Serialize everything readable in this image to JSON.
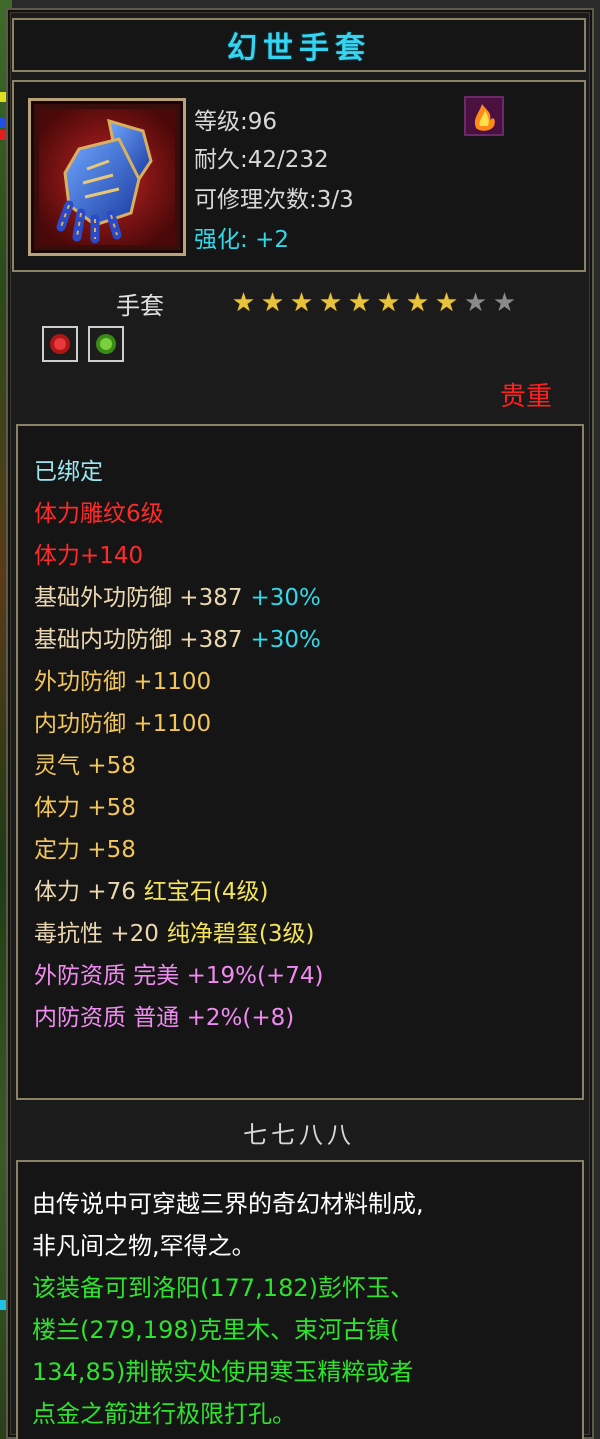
{
  "item": {
    "name": "幻世手套",
    "level_text": "等级:96",
    "durability_text": "耐久:42/232",
    "repairs_text": "可修理次数:3/3",
    "enhance_label": "强化:",
    "enhance_value": "+2",
    "type": "手套",
    "stars_total": 10,
    "stars_filled": 7.5,
    "quality": "贵重",
    "gem_slots": [
      {
        "color": "#d82020"
      },
      {
        "color": "#58c028"
      }
    ]
  },
  "attributes": [
    {
      "text": "已绑定",
      "color": "cyan"
    },
    {
      "text": "体力雕纹6级",
      "color": "red"
    },
    {
      "text": "体力+140",
      "color": "red"
    },
    {
      "text": "基础外功防御 +387",
      "extra": "+30%",
      "color": "tan"
    },
    {
      "text": "基础内功防御 +387",
      "extra": "+30%",
      "color": "tan"
    },
    {
      "text": "外功防御 +1100",
      "color": "gold"
    },
    {
      "text": "内功防御 +1100",
      "color": "gold"
    },
    {
      "text": "灵气 +58",
      "color": "gold"
    },
    {
      "text": "体力 +58",
      "color": "gold"
    },
    {
      "text": "定力 +58",
      "color": "gold"
    },
    {
      "text": "体力 +76",
      "extra": "红宝石(4级)",
      "color": "tan"
    },
    {
      "text": "毒抗性 +20",
      "extra": "纯净碧玺(3级)",
      "color": "tan"
    },
    {
      "text": "外防资质  完美 +19%(+74)",
      "color": "pink"
    },
    {
      "text": "内防资质  普通 +2%(+8)",
      "color": "pink"
    }
  ],
  "maker": "七七八八",
  "description": [
    {
      "text": "由传说中可穿越三界的奇幻材料制成,",
      "color": "white"
    },
    {
      "text": "非凡间之物,罕得之。",
      "color": "white"
    },
    {
      "text": "该装备可到洛阳(177,182)彭怀玉、",
      "color": "green"
    },
    {
      "text": "楼兰(279,198)克里木、束河古镇(",
      "color": "green"
    },
    {
      "text": "134,85)荆嵌实处使用寒玉精粹或者",
      "color": "green"
    },
    {
      "text": "点金之箭进行极限打孔。",
      "color": "green"
    }
  ],
  "icons": {
    "item": "gauntlet-icon",
    "skill": "flame-skill-icon",
    "star": "star-icon"
  }
}
